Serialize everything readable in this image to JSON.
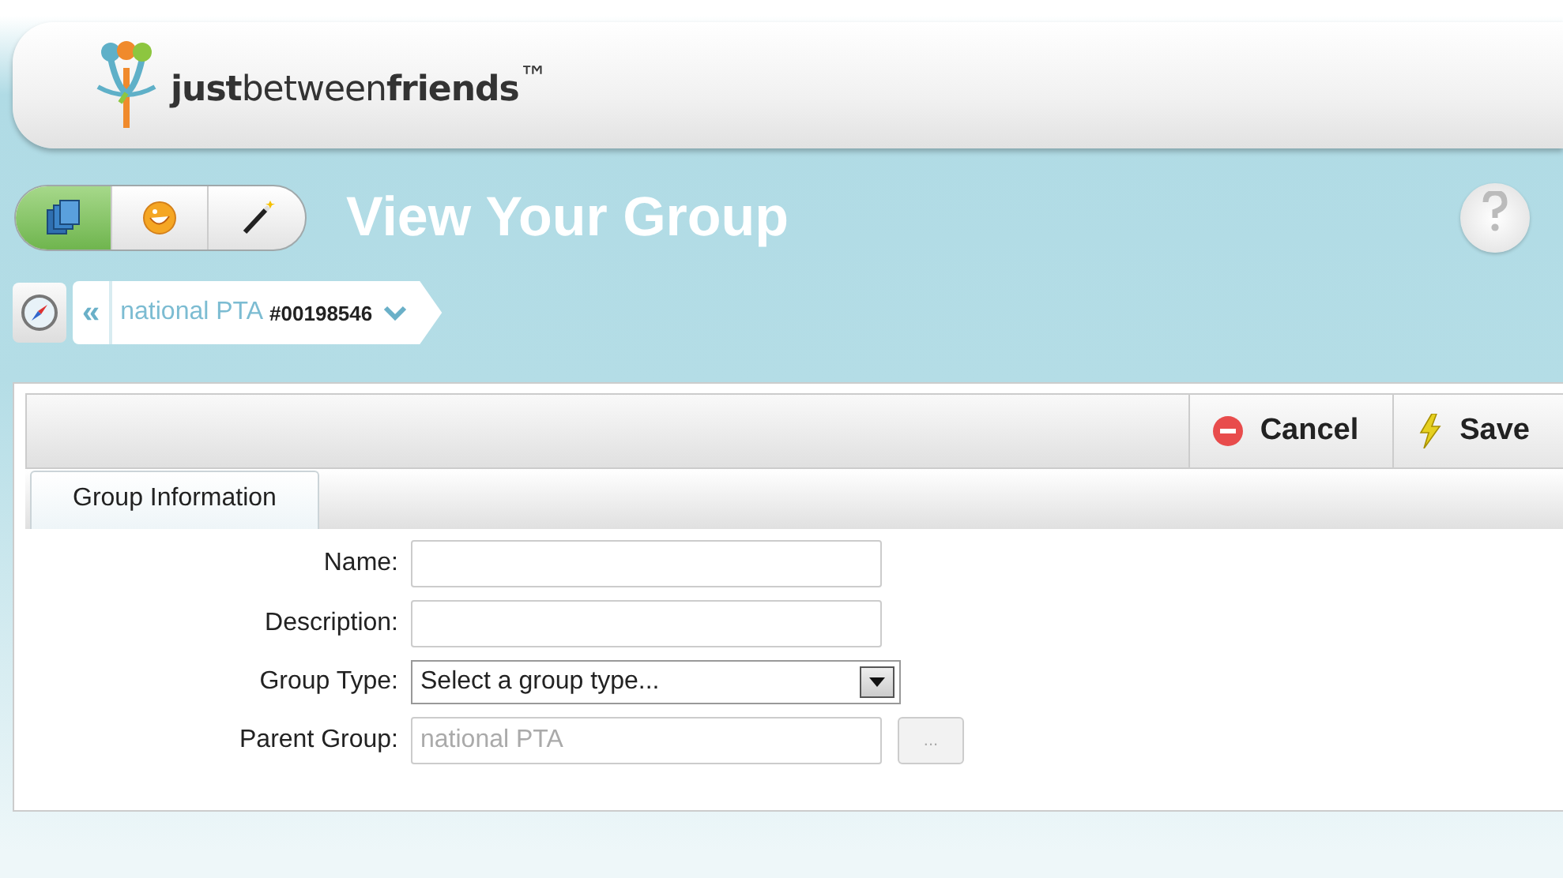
{
  "header": {
    "logo": "**just**between**friends**$^{™}$"
  },
  "toolbar": {
    "tools": [
      {
        "kind": "books",
        "selected": true
      },
      {
        "kind": "smiley",
        "selected": false
      },
      {
        "kind": "wand",
        "selected": false
      }
    ],
    "title": "View Your Group"
  },
  "breadcrumb": {
    "back": "«",
    "name": "national PTA",
    "number": "#00198546"
  },
  "actions": [
    {
      "kind": "cancel",
      "label": "Cancel"
    },
    {
      "kind": "save",
      "label": "Save"
    }
  ],
  "tabs": [
    {
      "label": "Group Information",
      "selected": true
    }
  ],
  "form": [
    {
      "kind": "text",
      "label": "Name:"
    },
    {
      "kind": "text",
      "label": "Description:"
    },
    {
      "kind": "select",
      "label": "Group Type:",
      "value": "Select a group type..."
    },
    {
      "kind": "lookup",
      "label": "Parent Group:",
      "value": "national PTA",
      "disabled": true,
      "button": "..."
    }
  ]
}
